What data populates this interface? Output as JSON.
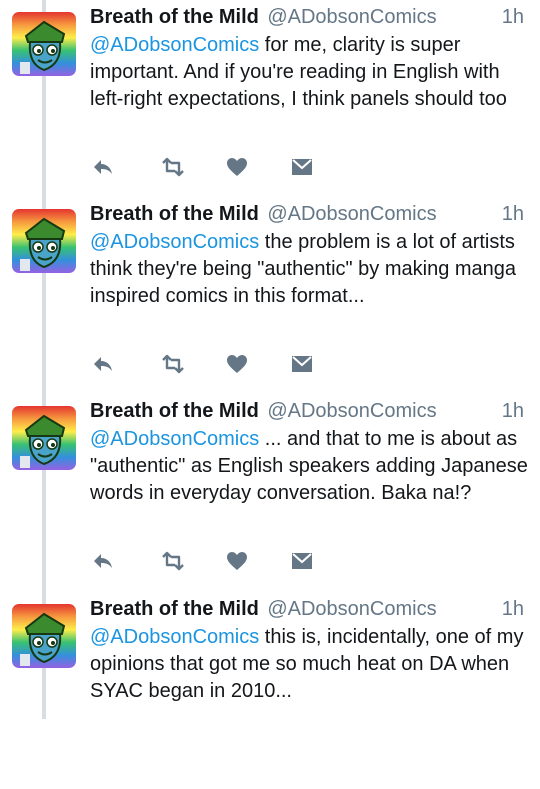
{
  "tweets": [
    {
      "author": "Breath of the Mild",
      "handle": "@ADobsonComics",
      "time": "1h",
      "mention": "@ADobsonComics",
      "text": " for me, clarity is super important. And if you're reading in English with left-right expectations, I think panels should too"
    },
    {
      "author": "Breath of the Mild",
      "handle": "@ADobsonComics",
      "time": "1h",
      "mention": "@ADobsonComics",
      "text": " the problem is a lot of artists think they're being \"authentic\" by making manga inspired comics in this format..."
    },
    {
      "author": "Breath of the Mild",
      "handle": "@ADobsonComics",
      "time": "1h",
      "mention": "@ADobsonComics",
      "text": " ... and that to me is about as \"authentic\" as English speakers adding Japanese words in everyday conversation. Baka na!?"
    },
    {
      "author": "Breath of the Mild",
      "handle": "@ADobsonComics",
      "time": "1h",
      "mention": "@ADobsonComics",
      "text": " this is, incidentally, one of my opinions that got me so much heat on DA when SYAC began in 2010..."
    }
  ],
  "actions": [
    "reply-icon",
    "retweet-icon",
    "like-icon",
    "direct-message-icon"
  ],
  "colors": {
    "mention": "#1b95e0",
    "secondary_text": "#657786",
    "action_icon": "#657786",
    "thread_line": "#d7dde2"
  }
}
